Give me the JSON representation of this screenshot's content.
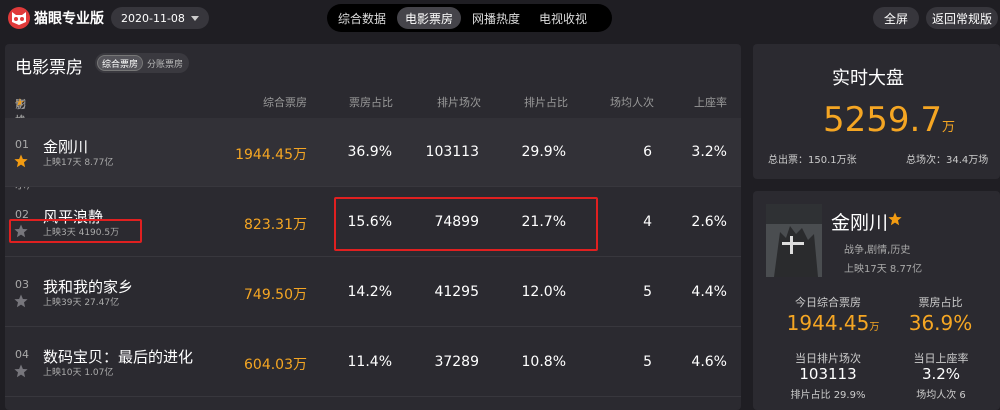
{
  "header": {
    "brand": "猫眼专业版",
    "date": "2020-11-08",
    "tabs": [
      "综合数据",
      "电影票房",
      "网播热度",
      "电视收视"
    ],
    "fullscreen": "全屏",
    "back": "返回常规版"
  },
  "main": {
    "title": "电影票房",
    "sub_tabs": [
      "综合票房",
      "分账票房"
    ],
    "columns": {
      "film_prefix": "影片 (点击",
      "film_star": "★",
      "film_suffix": "切换右侧展示)",
      "box": "综合票房",
      "share": "票房占比",
      "schedule": "排片场次",
      "schedule_share": "排片占比",
      "avg": "场均人次",
      "occupancy": "上座率"
    },
    "rows": [
      {
        "rank": "01",
        "name": "金刚川",
        "sub": "上映17天  8.77亿",
        "box": "1944.45万",
        "share": "36.9%",
        "schedule": "103113",
        "schedule_share": "29.9%",
        "avg": "6",
        "occupancy": "3.2%",
        "starred": true
      },
      {
        "rank": "02",
        "name": "风平浪静",
        "sub": "上映3天  4190.5万",
        "box": "823.31万",
        "share": "15.6%",
        "schedule": "74899",
        "schedule_share": "21.7%",
        "avg": "4",
        "occupancy": "2.6%",
        "starred": false
      },
      {
        "rank": "03",
        "name": "我和我的家乡",
        "sub": "上映39天  27.47亿",
        "box": "749.50万",
        "share": "14.2%",
        "schedule": "41295",
        "schedule_share": "12.0%",
        "avg": "5",
        "occupancy": "4.4%",
        "starred": false
      },
      {
        "rank": "04",
        "name": "数码宝贝：最后的进化",
        "sub": "上映10天  1.07亿",
        "box": "604.03万",
        "share": "11.4%",
        "schedule": "37289",
        "schedule_share": "10.8%",
        "avg": "5",
        "occupancy": "4.6%",
        "starred": false
      }
    ]
  },
  "realtime": {
    "title": "实时大盘",
    "value": "5259.7",
    "unit": "万",
    "total_tickets": "总出票：150.1万张",
    "total_shows": "总场次：34.4万场"
  },
  "detail": {
    "name": "金刚川",
    "genre": "战争,剧情,历史",
    "sub": "上映17天  8.77亿",
    "today_box_label": "今日综合票房",
    "today_box": "1944.45",
    "today_box_unit": "万",
    "box_share_label": "票房占比",
    "box_share": "36.9%",
    "shows_label": "当日排片场次",
    "shows": "103113",
    "shows_share": "排片占比 29.9%",
    "occ_label": "当日上座率",
    "occ": "3.2%",
    "avg": "场均人次 6"
  },
  "colors": {
    "accent": "#f5a623",
    "highlight_box": "#e02020"
  }
}
